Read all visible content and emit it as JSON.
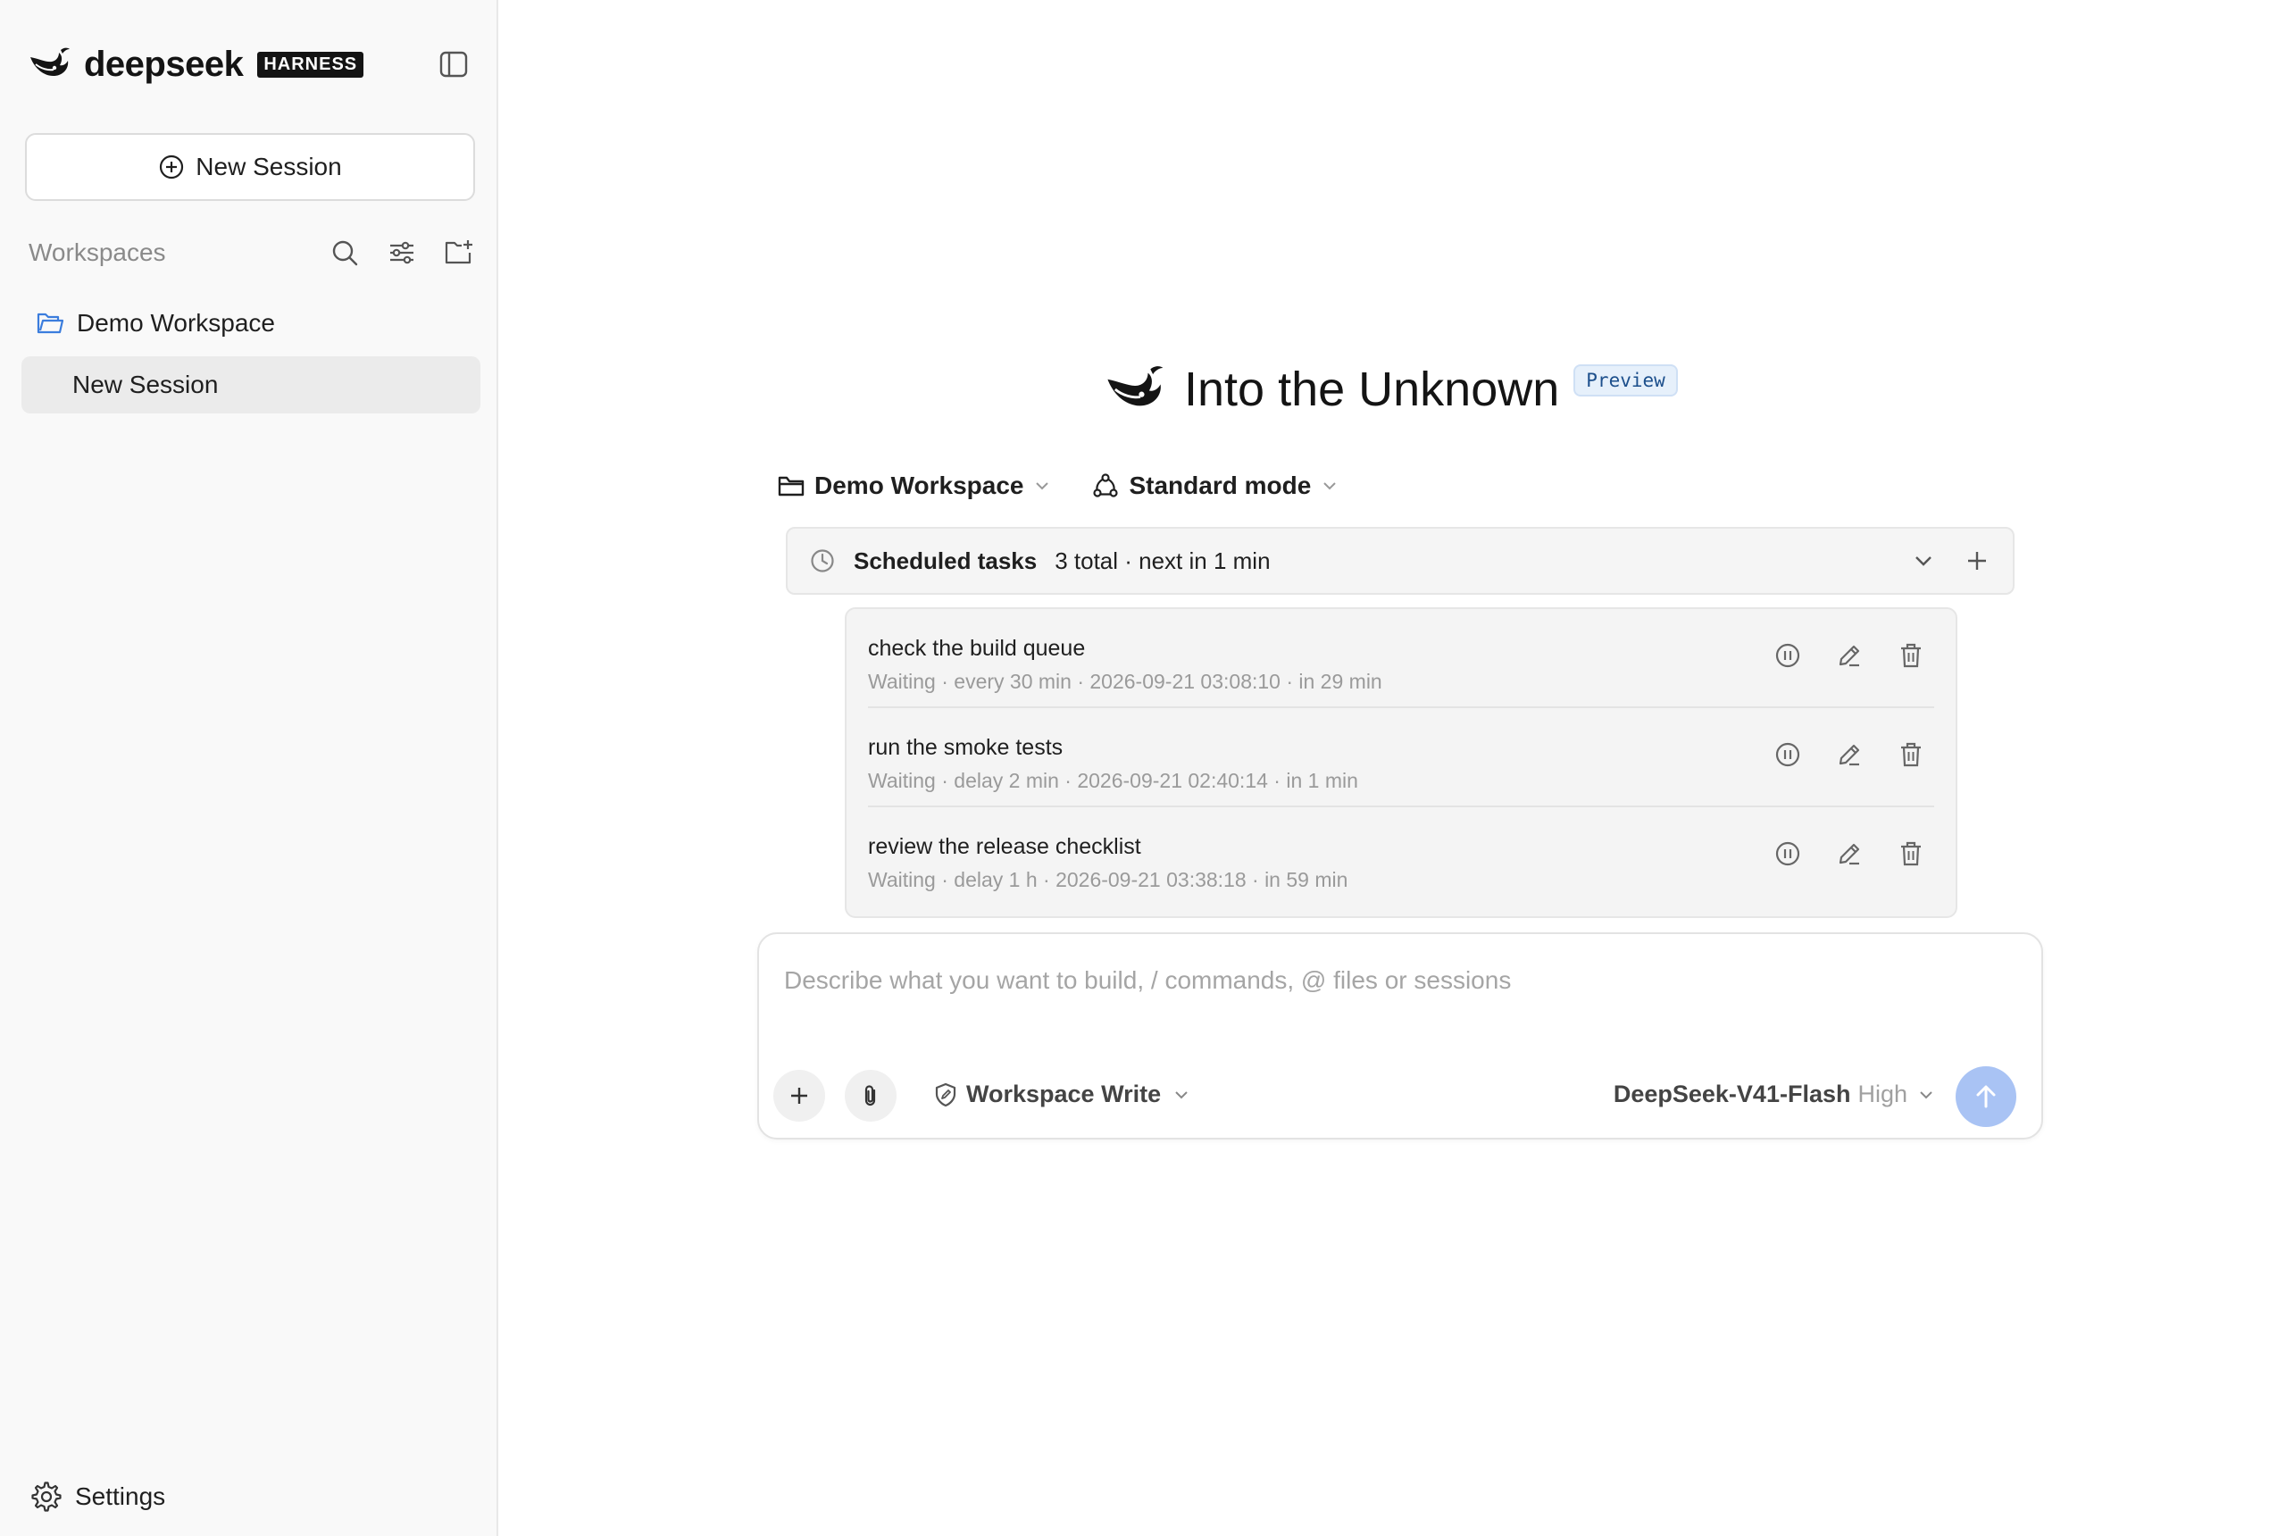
{
  "sidebar": {
    "logo_text": "deepseek",
    "logo_badge": "HARNESS",
    "new_session_label": "New Session",
    "workspaces_title": "Workspaces",
    "workspaces": [
      {
        "name": "Demo Workspace",
        "sessions": [
          {
            "label": "New Session",
            "active": true
          }
        ]
      }
    ],
    "settings_label": "Settings"
  },
  "hero": {
    "title": "Into the Unknown",
    "badge": "Preview"
  },
  "selectors": {
    "workspace": "Demo Workspace",
    "mode": "Standard mode"
  },
  "scheduled": {
    "title": "Scheduled tasks",
    "summary": "3 total · next in 1 min",
    "tasks": [
      {
        "name": "check the build queue",
        "meta": "Waiting · every 30 min · 2026-09-21 03:08:10 · in 29 min"
      },
      {
        "name": "run the smoke tests",
        "meta": "Waiting · delay 2 min · 2026-09-21 02:40:14 · in 1 min"
      },
      {
        "name": "review the release checklist",
        "meta": "Waiting · delay 1 h · 2026-09-21 03:38:18 · in 59 min"
      }
    ]
  },
  "composer": {
    "placeholder": "Describe what you want to build, / commands, @ files or sessions",
    "value": "",
    "permission": "Workspace Write",
    "model": "DeepSeek-V41-Flash",
    "reasoning": "High"
  },
  "colors": {
    "sidebar_bg": "#f9f9f9",
    "active_item_bg": "#ebebeb",
    "folder_icon": "#3b7ddd",
    "send_button": "#a9c3f4",
    "preview_badge_bg": "#e6f0fb"
  }
}
